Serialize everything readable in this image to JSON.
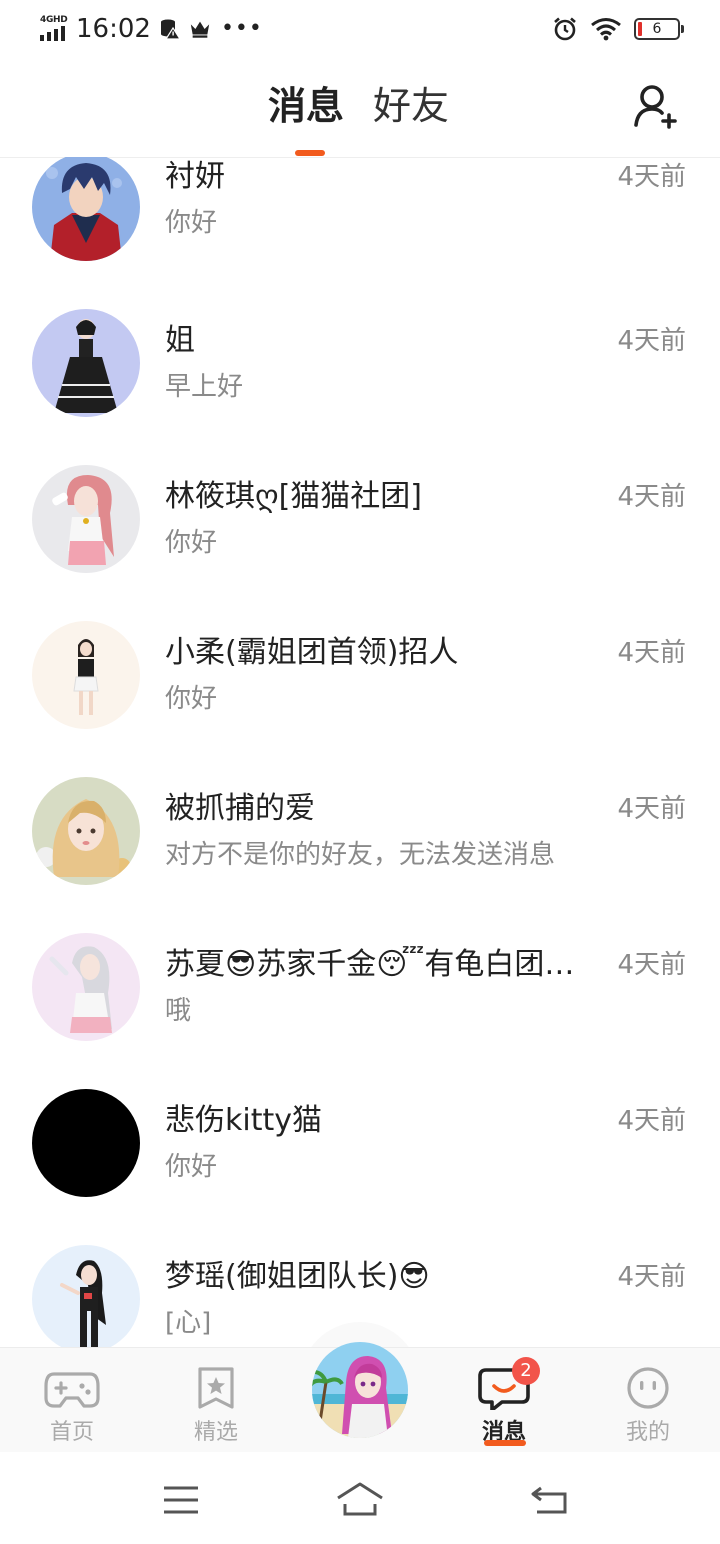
{
  "status_bar": {
    "network": "4GHD",
    "time": "16:02",
    "battery": "6"
  },
  "header": {
    "tabs": [
      {
        "label": "消息",
        "active": true
      },
      {
        "label": "好友",
        "active": false
      }
    ],
    "accent_color": "#f25b1e",
    "add_friend_icon": "add-user-icon"
  },
  "messages": [
    {
      "name": "衬妍",
      "preview": "你好",
      "time": "4天前"
    },
    {
      "name": "姐",
      "preview": "早上好",
      "time": "4天前"
    },
    {
      "name": "林筱琪ღ[猫猫社团]",
      "preview": "你好",
      "time": "4天前"
    },
    {
      "name": "小柔(霸姐团首领)招人",
      "preview": "你好",
      "time": "4天前"
    },
    {
      "name": "被抓捕的爱",
      "preview": "对方不是你的好友，无法发送消息",
      "time": "4天前"
    },
    {
      "name": "苏夏😎苏家千金😴有龟白团…",
      "preview": "哦",
      "time": "4天前"
    },
    {
      "name": "悲伤kitty猫",
      "preview": "你好",
      "time": "4天前"
    },
    {
      "name": "梦瑶(御姐团队长)😎",
      "preview": "[心]",
      "time": "4天前"
    }
  ],
  "bottom_nav": {
    "items": [
      {
        "label": "首页",
        "icon": "gamepad-icon"
      },
      {
        "label": "精选",
        "icon": "star-bookmark-icon"
      },
      {
        "label": "",
        "icon": "center-avatar"
      },
      {
        "label": "消息",
        "icon": "chat-bubble-icon",
        "active": true,
        "badge": "2"
      },
      {
        "label": "我的",
        "icon": "face-icon"
      }
    ]
  }
}
